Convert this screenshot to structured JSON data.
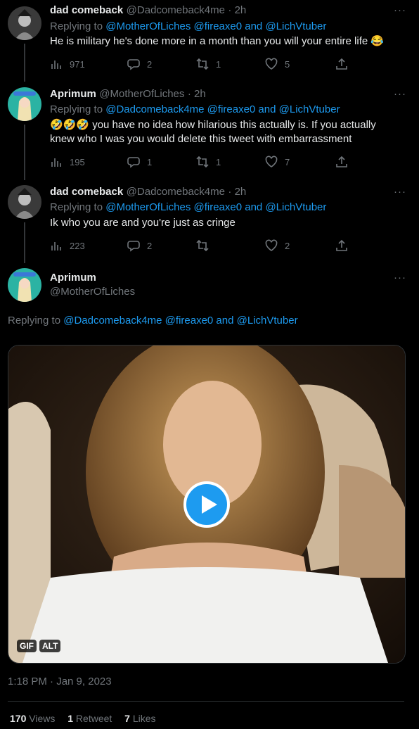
{
  "tweets": [
    {
      "display_name": "dad comeback",
      "handle": "@Dadcomeback4me",
      "time": "· 2h",
      "replying_prefix": "Replying to",
      "replying_to": "@MotherOfLiches @fireaxe0 and @LichVtuber",
      "text": "He is military he's done more in a month than you will your entire life 😂",
      "views": "971",
      "replies": "2",
      "retweets": "1",
      "likes": "5"
    },
    {
      "display_name": "Aprimum",
      "handle": "@MotherOfLiches",
      "time": "· 2h",
      "replying_prefix": "Replying to",
      "replying_to": "@Dadcomeback4me @fireaxe0 and @LichVtuber",
      "text": "🤣🤣🤣 you have no idea how hilarious this actually is. If you actually knew who I was you would delete this tweet with embarrassment",
      "views": "195",
      "replies": "1",
      "retweets": "1",
      "likes": "7"
    },
    {
      "display_name": "dad comeback",
      "handle": "@Dadcomeback4me",
      "time": "· 2h",
      "replying_prefix": "Replying to",
      "replying_to": "@MotherOfLiches @fireaxe0 and @LichVtuber",
      "text": "Ik who you are and you're just as cringe",
      "views": "223",
      "replies": "2",
      "retweets": "",
      "likes": "2"
    }
  ],
  "main_tweet": {
    "display_name": "Aprimum",
    "handle": "@MotherOfLiches",
    "replying_prefix": "Replying to",
    "replying_to": "@Dadcomeback4me @fireaxe0 and @LichVtuber",
    "gif_badge": "GIF",
    "alt_badge": "ALT",
    "timestamp": "1:18 PM · Jan 9, 2023",
    "views_count": "170",
    "views_label": "Views",
    "retweets_count": "1",
    "retweets_label": "Retweet",
    "likes_count": "7",
    "likes_label": "Likes"
  },
  "more_glyph": "···",
  "colors": {
    "accent": "#1d9bf0",
    "muted": "#71767b",
    "background": "#000000"
  }
}
